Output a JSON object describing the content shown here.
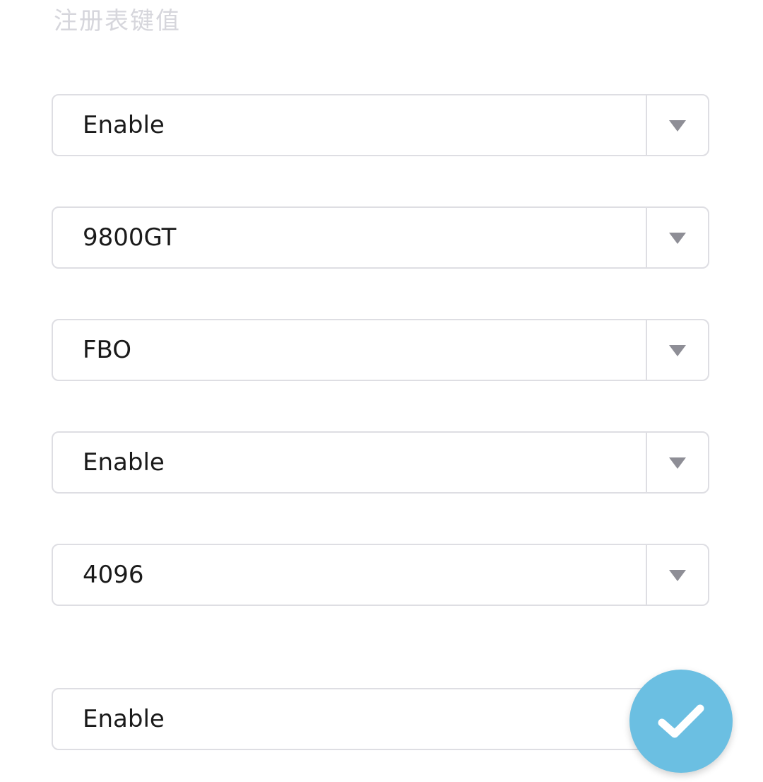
{
  "section": {
    "heading": "注册表键值"
  },
  "dropdowns": [
    {
      "value": "Enable"
    },
    {
      "value": "9800GT"
    },
    {
      "value": "FBO"
    },
    {
      "value": "Enable"
    },
    {
      "value": "4096"
    },
    {
      "value": "Enable"
    }
  ],
  "icons": {
    "dropdown_arrow": "caret-down-icon",
    "fab": "checkmark-icon"
  },
  "colors": {
    "accent": "#6bbfe2",
    "border": "#dedee3",
    "caret": "#8e8e96",
    "heading": "#d6d6dc"
  }
}
